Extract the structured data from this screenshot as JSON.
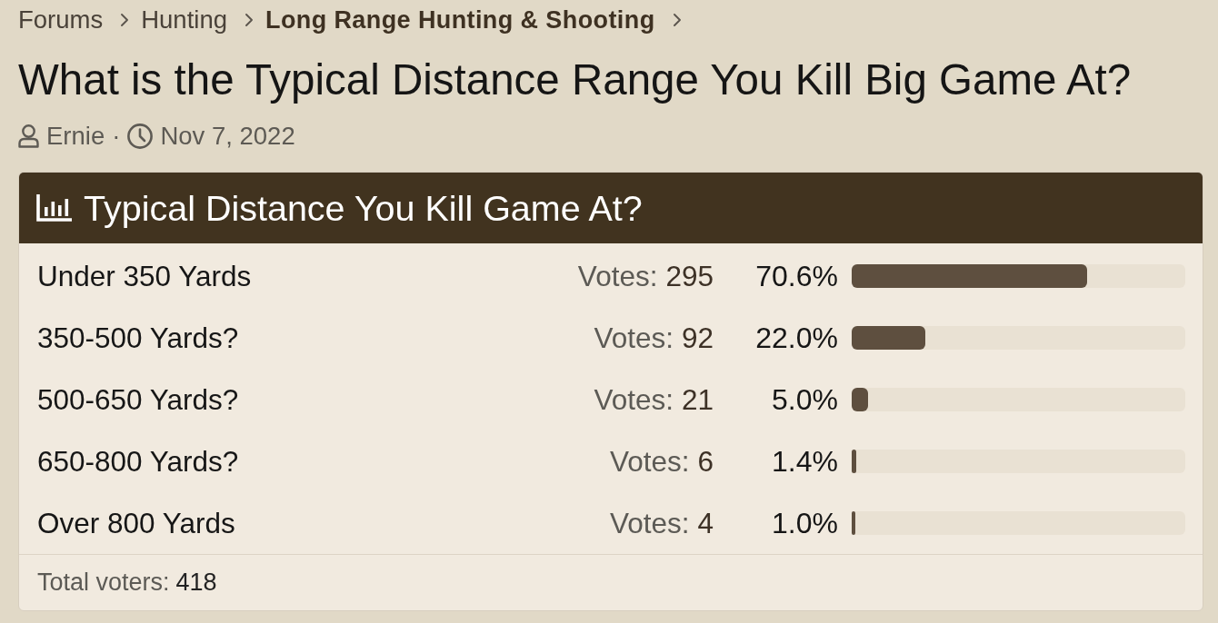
{
  "breadcrumbs": [
    {
      "label": "Forums",
      "current": false
    },
    {
      "label": "Hunting",
      "current": false
    },
    {
      "label": "Long Range Hunting & Shooting",
      "current": true
    }
  ],
  "thread": {
    "title": "What is the Typical Distance Range You Kill Big Game At?",
    "author": "Ernie",
    "separator": "·",
    "date": "Nov 7, 2022"
  },
  "poll": {
    "title": "Typical Distance You Kill Game At?",
    "options": [
      {
        "label": "Under 350 Yards",
        "votes_label": "Votes:",
        "votes": "295",
        "percent": "70.6%",
        "level": 0.706
      },
      {
        "label": "350-500 Yards?",
        "votes_label": "Votes:",
        "votes": "92",
        "percent": "22.0%",
        "level": 0.22
      },
      {
        "label": "500-650 Yards?",
        "votes_label": "Votes:",
        "votes": "21",
        "percent": "5.0%",
        "level": 0.05
      },
      {
        "label": "650-800 Yards?",
        "votes_label": "Votes:",
        "votes": "6",
        "percent": "1.4%",
        "level": 0.014
      },
      {
        "label": "Over 800 Yards",
        "votes_label": "Votes:",
        "votes": "4",
        "percent": "1.0%",
        "level": 0.01
      }
    ],
    "footer": {
      "label": "Total voters:",
      "value": "418"
    }
  }
}
